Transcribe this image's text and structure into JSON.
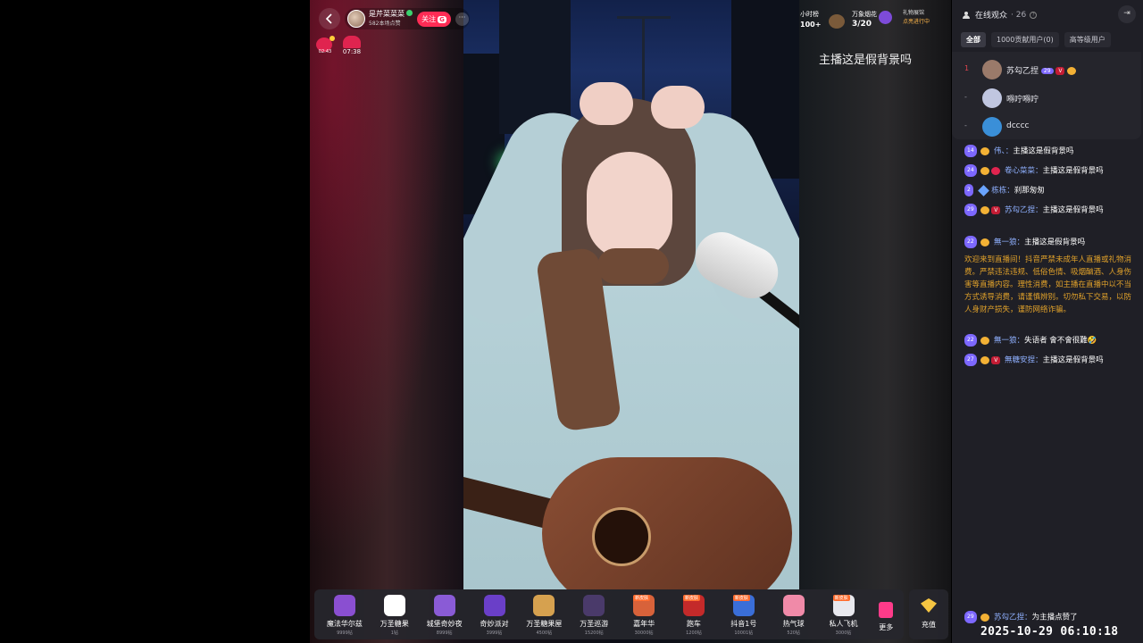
{
  "host": {
    "name": "是芹菜菜菜",
    "likes": "582本场点赞",
    "follow_label": "关注",
    "follow_badge": "G",
    "more": "···"
  },
  "badges": {
    "left_time": "02:43",
    "right_time": "07:38"
  },
  "top_right": {
    "rank_label": "小时榜",
    "rank_value": "100+",
    "fireworks_label": "万象烟花",
    "fireworks_value": "3/20",
    "gift_status_line1": "礼物展馆",
    "gift_status_line2": "点亮进行中"
  },
  "stream": {
    "caption": "主播这是假背景吗"
  },
  "gifts": [
    {
      "name": "魔法华尔兹",
      "price": "9999钻",
      "tag": "",
      "color": "#8a4fd1"
    },
    {
      "name": "万圣糖果",
      "price": "1钻",
      "tag": "",
      "color": "#ffffff"
    },
    {
      "name": "城堡奇妙夜",
      "price": "8999钻",
      "tag": "",
      "color": "#8a5bd6"
    },
    {
      "name": "奇妙派对",
      "price": "3999钻",
      "tag": "",
      "color": "#6a3fc8"
    },
    {
      "name": "万圣糖果屋",
      "price": "4500钻",
      "tag": "",
      "color": "#d6a14f"
    },
    {
      "name": "万圣巡游",
      "price": "15200钻",
      "tag": "",
      "color": "#4a3a6a"
    },
    {
      "name": "嘉年华",
      "price": "30000钻",
      "tag": "新皮肤",
      "color": "#d8623a"
    },
    {
      "name": "跑车",
      "price": "1200钻",
      "tag": "新皮肤",
      "color": "#c42a2a"
    },
    {
      "name": "抖音1号",
      "price": "10001钻",
      "tag": "新皮肤",
      "color": "#3a6ed8"
    },
    {
      "name": "热气球",
      "price": "520钻",
      "tag": "",
      "color": "#f08aa8"
    },
    {
      "name": "私人飞机",
      "price": "3000钻",
      "tag": "新皮肤",
      "color": "#e8e8ee"
    }
  ],
  "gift_more_label": "更多",
  "recharge_label": "充值",
  "panel": {
    "title": "在线观众",
    "count": "· 26",
    "tabs": [
      "全部",
      "1000贡献用户(0)",
      "高等级用户"
    ],
    "viewers": [
      {
        "rank": "1",
        "name": "苏勾乙捏",
        "level": "29",
        "avatar_color": "#9a7a6a"
      },
      {
        "rank": "-",
        "name": "嘚咛嘚咛",
        "level": "",
        "avatar_color": "#c0c6e0"
      },
      {
        "rank": "-",
        "name": "dcccc",
        "level": "",
        "avatar_color": "#3a8fd8"
      }
    ],
    "chat": [
      {
        "level": "14",
        "user": "伟、",
        "sep": "：",
        "text": "主播这是假背景吗"
      },
      {
        "level": "24",
        "user": "卷心菜菜",
        "sep": "：",
        "text": "主播这是假背景吗"
      },
      {
        "level": "2",
        "user": "栋栋",
        "sep": "：",
        "text": "刹那匆匆"
      },
      {
        "level": "29",
        "user": "苏勾乙捏",
        "sep": "：",
        "text": "主播这是假背景吗"
      },
      {
        "level": "22",
        "user": "無一狼",
        "sep": "：",
        "text": "主播这是假背景吗"
      },
      {
        "level": "22",
        "user": "無一狼",
        "sep": "：",
        "text": "失语者 會不會很難🤣"
      },
      {
        "level": "27",
        "user": "無糖安捏",
        "sep": "：",
        "text": "主播这是假背景吗"
      },
      {
        "level": "29",
        "user": "苏勾乙捏",
        "sep": "：",
        "text": "为主播点赞了"
      }
    ],
    "system_notice": "欢迎来到直播间！抖音严禁未成年人直播或礼物消费。严禁违法违规、低俗色情、吸烟酗酒、人身伤害等直播内容。理性消费，如主播在直播中以不当方式诱导消费，请谨慎辨别。切勿私下交易，以防人身财产损失，谨防网络诈骗。"
  },
  "timestamp": "2025-10-29 06:10:18"
}
